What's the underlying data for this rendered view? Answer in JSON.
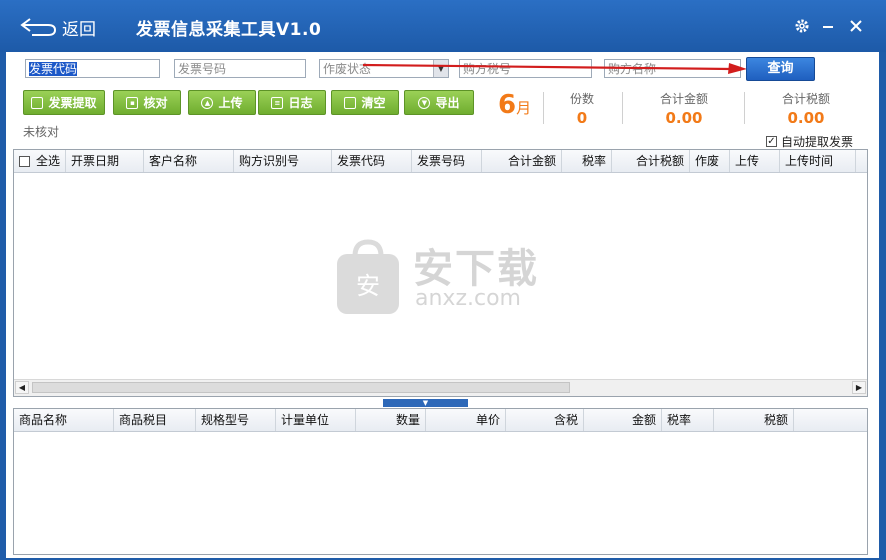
{
  "window": {
    "back_label": "返回",
    "title": "发票信息采集工具V1.0",
    "icons": [
      "gear-icon",
      "minimize-icon",
      "close-icon"
    ]
  },
  "search": {
    "invoice_code": "发票代码",
    "invoice_number": "发票号码",
    "void_status": "作废状态",
    "buyer_tax_no": "购方税号",
    "buyer_name": "购方名称",
    "query_label": "查询"
  },
  "toolbar": {
    "buttons": [
      {
        "label": "发票提取",
        "icon": "extract-icon"
      },
      {
        "label": "核对",
        "icon": "check-icon"
      },
      {
        "label": "上传",
        "icon": "upload-icon"
      },
      {
        "label": "日志",
        "icon": "log-icon"
      },
      {
        "label": "清空",
        "icon": "trash-icon"
      },
      {
        "label": "导出",
        "icon": "export-icon"
      }
    ]
  },
  "summary": {
    "month_num": "6",
    "month_unit": "月",
    "count_label": "份数",
    "count_value": "0",
    "total_amount_label": "合计金额",
    "total_amount_value": "0.00",
    "total_tax_label": "合计税额",
    "total_tax_value": "0.00"
  },
  "status_text": "未核对",
  "auto_extract": {
    "label": "自动提取发票",
    "checked": true,
    "mark": "✓"
  },
  "invoice_table": {
    "columns": [
      "全选",
      "开票日期",
      "客户名称",
      "购方识别号",
      "发票代码",
      "发票号码",
      "合计金额",
      "税率",
      "合计税额",
      "作废",
      "上传",
      "上传时间"
    ]
  },
  "detail_table": {
    "columns": [
      "商品名称",
      "商品税目",
      "规格型号",
      "计量单位",
      "数量",
      "单价",
      "含税",
      "金额",
      "税率",
      "税额"
    ]
  },
  "watermark": {
    "text": "安下载",
    "sub": "anxz.com"
  },
  "colors": {
    "titlebar": "#1f5ca9",
    "accent_orange": "#f27a18",
    "green_button": "#7cb938",
    "query_button": "#2a6fd0"
  }
}
